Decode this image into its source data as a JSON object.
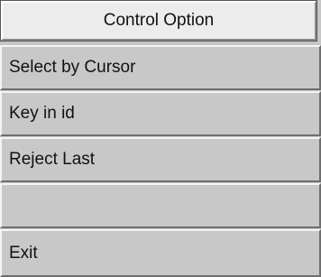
{
  "menu": {
    "title": "Control Option",
    "items": [
      {
        "label": "Select by Cursor"
      },
      {
        "label": "Key in id"
      },
      {
        "label": "Reject Last"
      },
      {
        "label": ""
      },
      {
        "label": "Exit"
      }
    ]
  }
}
